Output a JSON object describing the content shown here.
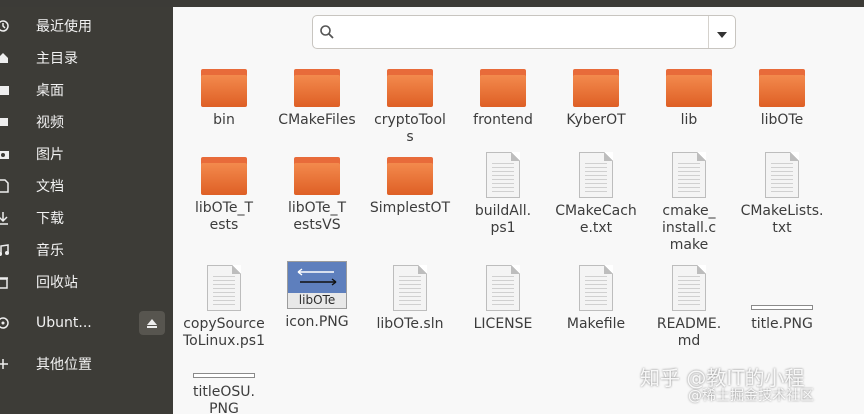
{
  "sidebar": {
    "items": [
      {
        "label": "最近使用",
        "icon": "clock-icon"
      },
      {
        "label": "主目录",
        "icon": "home-icon"
      },
      {
        "label": "桌面",
        "icon": "folder-icon"
      },
      {
        "label": "视频",
        "icon": "video-icon"
      },
      {
        "label": "图片",
        "icon": "camera-icon"
      },
      {
        "label": "文档",
        "icon": "document-icon"
      },
      {
        "label": "下载",
        "icon": "download-icon"
      },
      {
        "label": "音乐",
        "icon": "music-icon"
      },
      {
        "label": "回收站",
        "icon": "trash-icon"
      },
      {
        "label": "Ubunt...",
        "icon": "disc-icon"
      },
      {
        "label": "其他位置",
        "icon": "plus-icon"
      }
    ]
  },
  "search": {
    "placeholder": ""
  },
  "files": [
    {
      "name": "bin",
      "type": "folder"
    },
    {
      "name": "CMakeFiles",
      "type": "folder"
    },
    {
      "name": "cryptoTools",
      "type": "folder"
    },
    {
      "name": "frontend",
      "type": "folder"
    },
    {
      "name": "KyberOT",
      "type": "folder"
    },
    {
      "name": "lib",
      "type": "folder"
    },
    {
      "name": "libOTe",
      "type": "folder"
    },
    {
      "name": "libOTe_Tests",
      "type": "folder"
    },
    {
      "name": "libOTe_TestsVS",
      "type": "folder"
    },
    {
      "name": "SimplestOT",
      "type": "folder"
    },
    {
      "name": "buildAll.ps1",
      "type": "document"
    },
    {
      "name": "CMakeCache.txt",
      "type": "document"
    },
    {
      "name": "cmake_install.cmake",
      "type": "document"
    },
    {
      "name": "CMakeLists.txt",
      "type": "document"
    },
    {
      "name": "copySourceToLinux.ps1",
      "type": "document"
    },
    {
      "name": "icon.PNG",
      "type": "image",
      "thumb_caption": "libOTe"
    },
    {
      "name": "libOTe.sln",
      "type": "document"
    },
    {
      "name": "LICENSE",
      "type": "document"
    },
    {
      "name": "Makefile",
      "type": "document"
    },
    {
      "name": "README.md",
      "type": "document"
    },
    {
      "name": "title.PNG",
      "type": "thin-image"
    },
    {
      "name": "titleOSU.PNG",
      "type": "thin-image"
    }
  ],
  "watermark": {
    "line1": "知乎 @教IT的小程",
    "line2": "@稀土掘金技术社区"
  },
  "colors": {
    "sidebar": "#3d3c37",
    "folder": "#e86b3a",
    "background": "#f8f8f8"
  }
}
